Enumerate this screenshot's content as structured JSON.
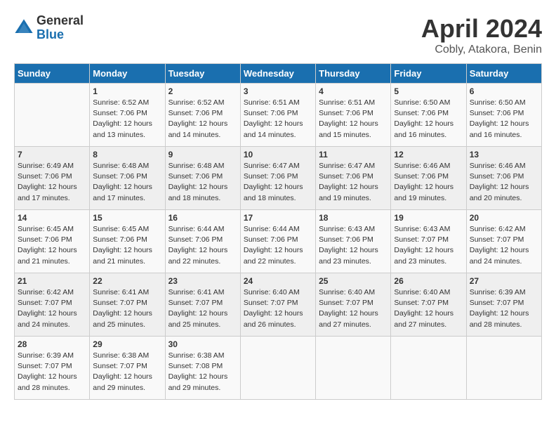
{
  "header": {
    "logo_general": "General",
    "logo_blue": "Blue",
    "month_title": "April 2024",
    "location": "Cobly, Atakora, Benin"
  },
  "days_of_week": [
    "Sunday",
    "Monday",
    "Tuesday",
    "Wednesday",
    "Thursday",
    "Friday",
    "Saturday"
  ],
  "weeks": [
    [
      {
        "day": "",
        "info": ""
      },
      {
        "day": "1",
        "info": "Sunrise: 6:52 AM\nSunset: 7:06 PM\nDaylight: 12 hours\nand 13 minutes."
      },
      {
        "day": "2",
        "info": "Sunrise: 6:52 AM\nSunset: 7:06 PM\nDaylight: 12 hours\nand 14 minutes."
      },
      {
        "day": "3",
        "info": "Sunrise: 6:51 AM\nSunset: 7:06 PM\nDaylight: 12 hours\nand 14 minutes."
      },
      {
        "day": "4",
        "info": "Sunrise: 6:51 AM\nSunset: 7:06 PM\nDaylight: 12 hours\nand 15 minutes."
      },
      {
        "day": "5",
        "info": "Sunrise: 6:50 AM\nSunset: 7:06 PM\nDaylight: 12 hours\nand 16 minutes."
      },
      {
        "day": "6",
        "info": "Sunrise: 6:50 AM\nSunset: 7:06 PM\nDaylight: 12 hours\nand 16 minutes."
      }
    ],
    [
      {
        "day": "7",
        "info": "Sunrise: 6:49 AM\nSunset: 7:06 PM\nDaylight: 12 hours\nand 17 minutes."
      },
      {
        "day": "8",
        "info": "Sunrise: 6:48 AM\nSunset: 7:06 PM\nDaylight: 12 hours\nand 17 minutes."
      },
      {
        "day": "9",
        "info": "Sunrise: 6:48 AM\nSunset: 7:06 PM\nDaylight: 12 hours\nand 18 minutes."
      },
      {
        "day": "10",
        "info": "Sunrise: 6:47 AM\nSunset: 7:06 PM\nDaylight: 12 hours\nand 18 minutes."
      },
      {
        "day": "11",
        "info": "Sunrise: 6:47 AM\nSunset: 7:06 PM\nDaylight: 12 hours\nand 19 minutes."
      },
      {
        "day": "12",
        "info": "Sunrise: 6:46 AM\nSunset: 7:06 PM\nDaylight: 12 hours\nand 19 minutes."
      },
      {
        "day": "13",
        "info": "Sunrise: 6:46 AM\nSunset: 7:06 PM\nDaylight: 12 hours\nand 20 minutes."
      }
    ],
    [
      {
        "day": "14",
        "info": "Sunrise: 6:45 AM\nSunset: 7:06 PM\nDaylight: 12 hours\nand 21 minutes."
      },
      {
        "day": "15",
        "info": "Sunrise: 6:45 AM\nSunset: 7:06 PM\nDaylight: 12 hours\nand 21 minutes."
      },
      {
        "day": "16",
        "info": "Sunrise: 6:44 AM\nSunset: 7:06 PM\nDaylight: 12 hours\nand 22 minutes."
      },
      {
        "day": "17",
        "info": "Sunrise: 6:44 AM\nSunset: 7:06 PM\nDaylight: 12 hours\nand 22 minutes."
      },
      {
        "day": "18",
        "info": "Sunrise: 6:43 AM\nSunset: 7:06 PM\nDaylight: 12 hours\nand 23 minutes."
      },
      {
        "day": "19",
        "info": "Sunrise: 6:43 AM\nSunset: 7:07 PM\nDaylight: 12 hours\nand 23 minutes."
      },
      {
        "day": "20",
        "info": "Sunrise: 6:42 AM\nSunset: 7:07 PM\nDaylight: 12 hours\nand 24 minutes."
      }
    ],
    [
      {
        "day": "21",
        "info": "Sunrise: 6:42 AM\nSunset: 7:07 PM\nDaylight: 12 hours\nand 24 minutes."
      },
      {
        "day": "22",
        "info": "Sunrise: 6:41 AM\nSunset: 7:07 PM\nDaylight: 12 hours\nand 25 minutes."
      },
      {
        "day": "23",
        "info": "Sunrise: 6:41 AM\nSunset: 7:07 PM\nDaylight: 12 hours\nand 25 minutes."
      },
      {
        "day": "24",
        "info": "Sunrise: 6:40 AM\nSunset: 7:07 PM\nDaylight: 12 hours\nand 26 minutes."
      },
      {
        "day": "25",
        "info": "Sunrise: 6:40 AM\nSunset: 7:07 PM\nDaylight: 12 hours\nand 27 minutes."
      },
      {
        "day": "26",
        "info": "Sunrise: 6:40 AM\nSunset: 7:07 PM\nDaylight: 12 hours\nand 27 minutes."
      },
      {
        "day": "27",
        "info": "Sunrise: 6:39 AM\nSunset: 7:07 PM\nDaylight: 12 hours\nand 28 minutes."
      }
    ],
    [
      {
        "day": "28",
        "info": "Sunrise: 6:39 AM\nSunset: 7:07 PM\nDaylight: 12 hours\nand 28 minutes."
      },
      {
        "day": "29",
        "info": "Sunrise: 6:38 AM\nSunset: 7:07 PM\nDaylight: 12 hours\nand 29 minutes."
      },
      {
        "day": "30",
        "info": "Sunrise: 6:38 AM\nSunset: 7:08 PM\nDaylight: 12 hours\nand 29 minutes."
      },
      {
        "day": "",
        "info": ""
      },
      {
        "day": "",
        "info": ""
      },
      {
        "day": "",
        "info": ""
      },
      {
        "day": "",
        "info": ""
      }
    ]
  ]
}
